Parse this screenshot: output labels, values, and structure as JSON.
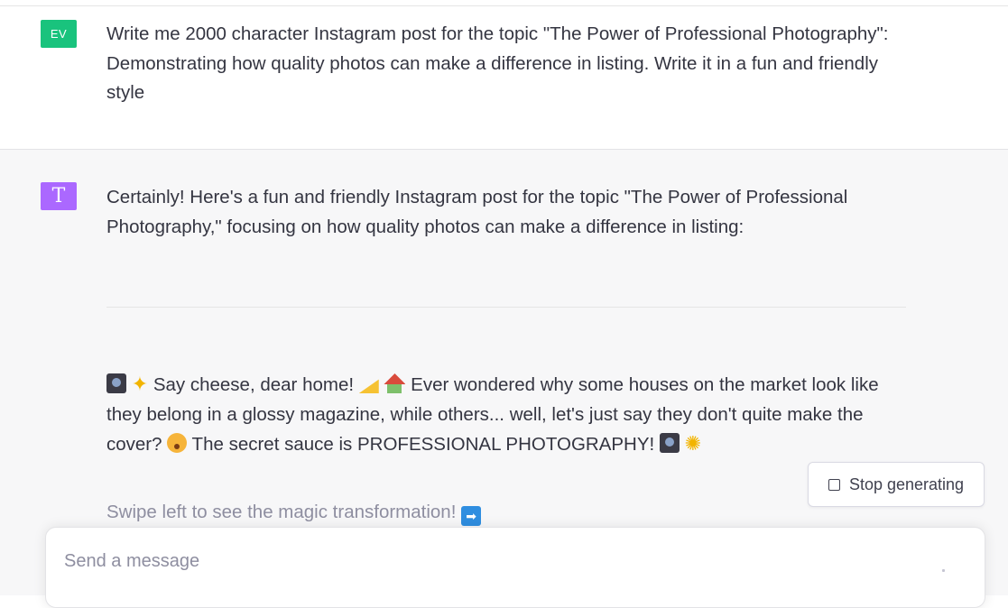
{
  "user_message": {
    "avatar_initials": "EV",
    "text": "Write me 2000 character Instagram post for  the topic  \"The Power of Professional Photography\": Demonstrating how quality photos can make a difference in listing. Write it in a fun and friendly style"
  },
  "assistant_message": {
    "avatar_letter": "T",
    "intro": "Certainly! Here's a fun and friendly Instagram post for the topic \"The Power of Professional Photography,\" focusing on how quality photos can make a difference in listing:",
    "post_segments": [
      " Say cheese, dear home! ",
      " Ever wondered why some houses on the market look like they belong in a glossy magazine, while others... well, let's just say they don't quite make the cover? ",
      " The secret sauce is PROFESSIONAL PHOTOGRAPHY! "
    ],
    "swipe_text": "Swipe left to see the magic transformation! "
  },
  "stop_button": {
    "label": "Stop generating"
  },
  "composer": {
    "placeholder": "Send a message"
  },
  "icons": [
    "camera-emoji",
    "sparkles-emoji",
    "cheese-emoji",
    "house-emoji",
    "flushed-face-emoji",
    "dizzy-emoji",
    "right-arrow-emoji",
    "stop-icon",
    "send-icon"
  ],
  "colors": {
    "user_avatar": "#19c37d",
    "assistant_avatar": "#ab68ff",
    "assistant_bg": "#f7f7f8",
    "text": "#343541",
    "muted_text": "#8e8ea0"
  }
}
